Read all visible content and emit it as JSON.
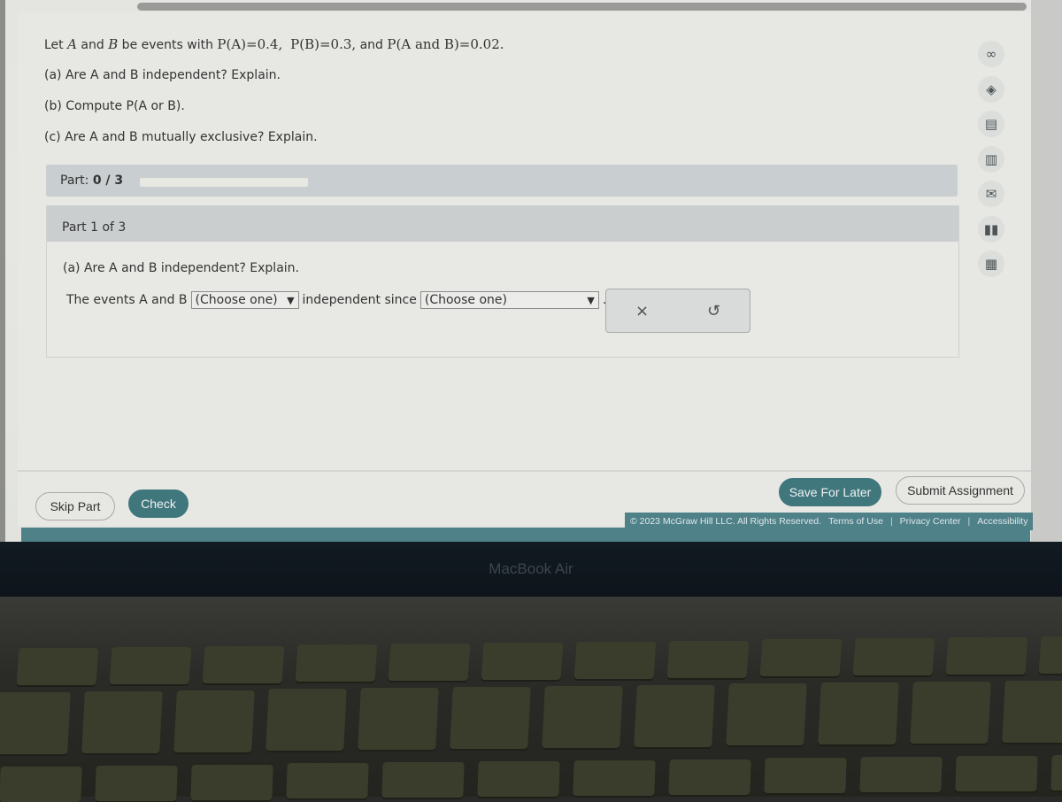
{
  "problem": {
    "intro_prefix": "Let ",
    "event_a": "A",
    "and_word": " and ",
    "event_b": "B",
    "intro_mid": " be events with ",
    "pa": "P(A)=0.4,",
    "pb": "P(B)=0.3,",
    "and_text": " and ",
    "pab": "P(A and B)=0.02.",
    "question_a": "(a) Are A and B independent? Explain.",
    "question_b": "(b) Compute P(A or B).",
    "question_c": "(c) Are A and B mutually exclusive? Explain."
  },
  "progress": {
    "label": "Part: ",
    "value_text": "0 / 3",
    "fraction": 0
  },
  "part": {
    "header": "Part 1 of 3",
    "question": "(a) Are A and B independent? Explain.",
    "answer_prefix": "The events A and B",
    "select1_value": "(Choose one)",
    "answer_middle": "independent since",
    "select2_value": "(Choose one)",
    "answer_end": "."
  },
  "actions": {
    "clear_icon": "×",
    "undo_icon": "↺"
  },
  "side_tools": [
    {
      "name": "glasses-icon",
      "glyph": "∞"
    },
    {
      "name": "direction-icon",
      "glyph": "◈"
    },
    {
      "name": "notes-icon",
      "glyph": "▤"
    },
    {
      "name": "ebook-icon",
      "glyph": "▥"
    },
    {
      "name": "mail-icon",
      "glyph": "✉"
    },
    {
      "name": "bar-chart-icon",
      "glyph": "▮▮"
    },
    {
      "name": "formula-icon",
      "glyph": "▦"
    }
  ],
  "buttons": {
    "skip": "Skip Part",
    "check": "Check",
    "save": "Save For Later",
    "submit": "Submit Assignment"
  },
  "footer": {
    "copyright": "© 2023 McGraw Hill LLC. All Rights Reserved.",
    "terms": "Terms of Use",
    "privacy": "Privacy Center",
    "accessibility": "Accessibility",
    "separator": "|"
  },
  "device": {
    "label": "MacBook Air"
  },
  "colors": {
    "primary": "#3f777d",
    "footer": "#4f8189"
  }
}
